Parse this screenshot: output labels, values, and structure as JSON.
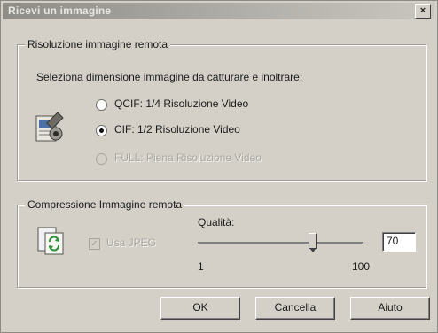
{
  "window": {
    "title": "Ricevi un immagine",
    "close_glyph": "×"
  },
  "resolution": {
    "legend": "Risoluzione immagine remota",
    "prompt": "Seleziona dimensione immagine da catturare e inoltrare:",
    "options": [
      {
        "label": "QCIF: 1/4 Risoluzione Video",
        "checked": false,
        "enabled": true
      },
      {
        "label": "CIF: 1/2 Risoluzione Video",
        "checked": true,
        "enabled": true
      },
      {
        "label": "FULL: Piena Risoluzione Video",
        "checked": false,
        "enabled": false
      }
    ],
    "icon": "camera-settings-icon"
  },
  "compression": {
    "legend": "Compressione Immagine remota",
    "icon": "image-refresh-icon",
    "use_jpeg_label": "Usa JPEG",
    "use_jpeg_checked": true,
    "use_jpeg_enabled": false,
    "quality_label": "Qualità:",
    "quality_value": "70",
    "slider_min": "1",
    "slider_max": "100"
  },
  "buttons": {
    "ok": "OK",
    "cancel": "Cancella",
    "help": "Aiuto"
  }
}
